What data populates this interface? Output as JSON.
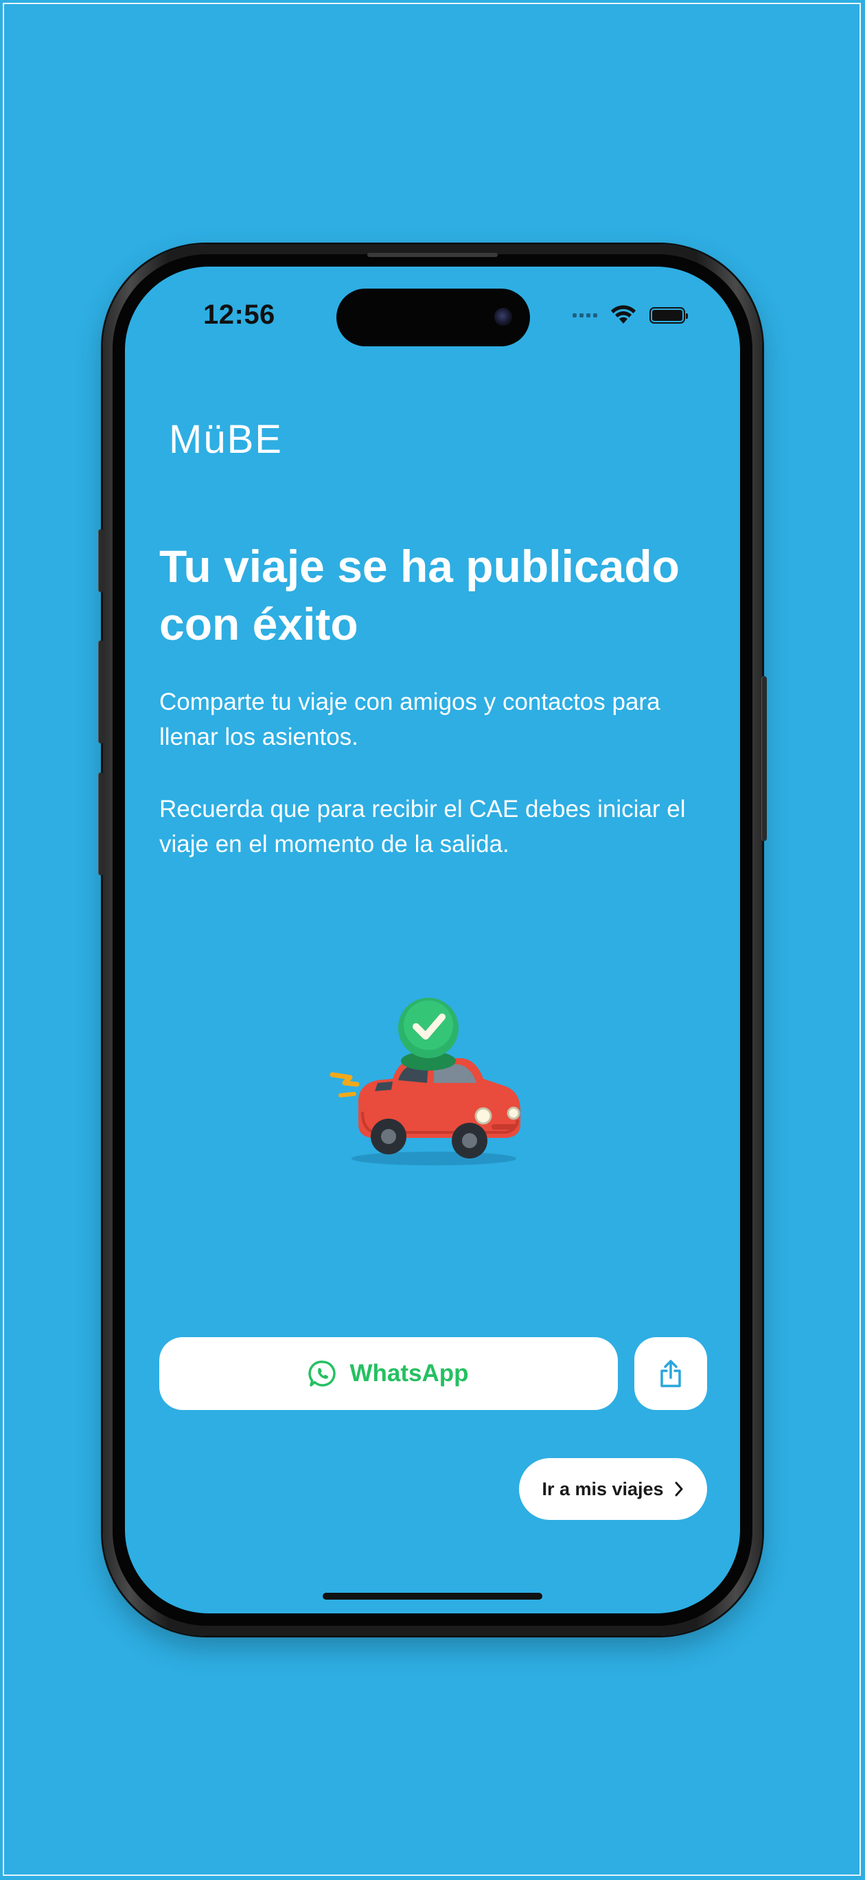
{
  "status_bar": {
    "time": "12:56"
  },
  "brand": {
    "logo_text": "MüBE"
  },
  "content": {
    "title": "Tu viaje se ha publicado con éxito",
    "paragraph_1": "Comparte tu viaje con amigos y contactos para llenar los asientos.",
    "paragraph_2": "Recuerda que para recibir el CAE debes iniciar el viaje en el momento de la salida."
  },
  "actions": {
    "whatsapp_label": "WhatsApp",
    "share_icon": "share-icon",
    "my_trips_label": "Ir a mis viajes",
    "my_trips_icon": "chevron-right-icon"
  },
  "colors": {
    "background": "#2eaee3",
    "whatsapp_green": "#25c061",
    "button_bg": "#ffffff"
  }
}
